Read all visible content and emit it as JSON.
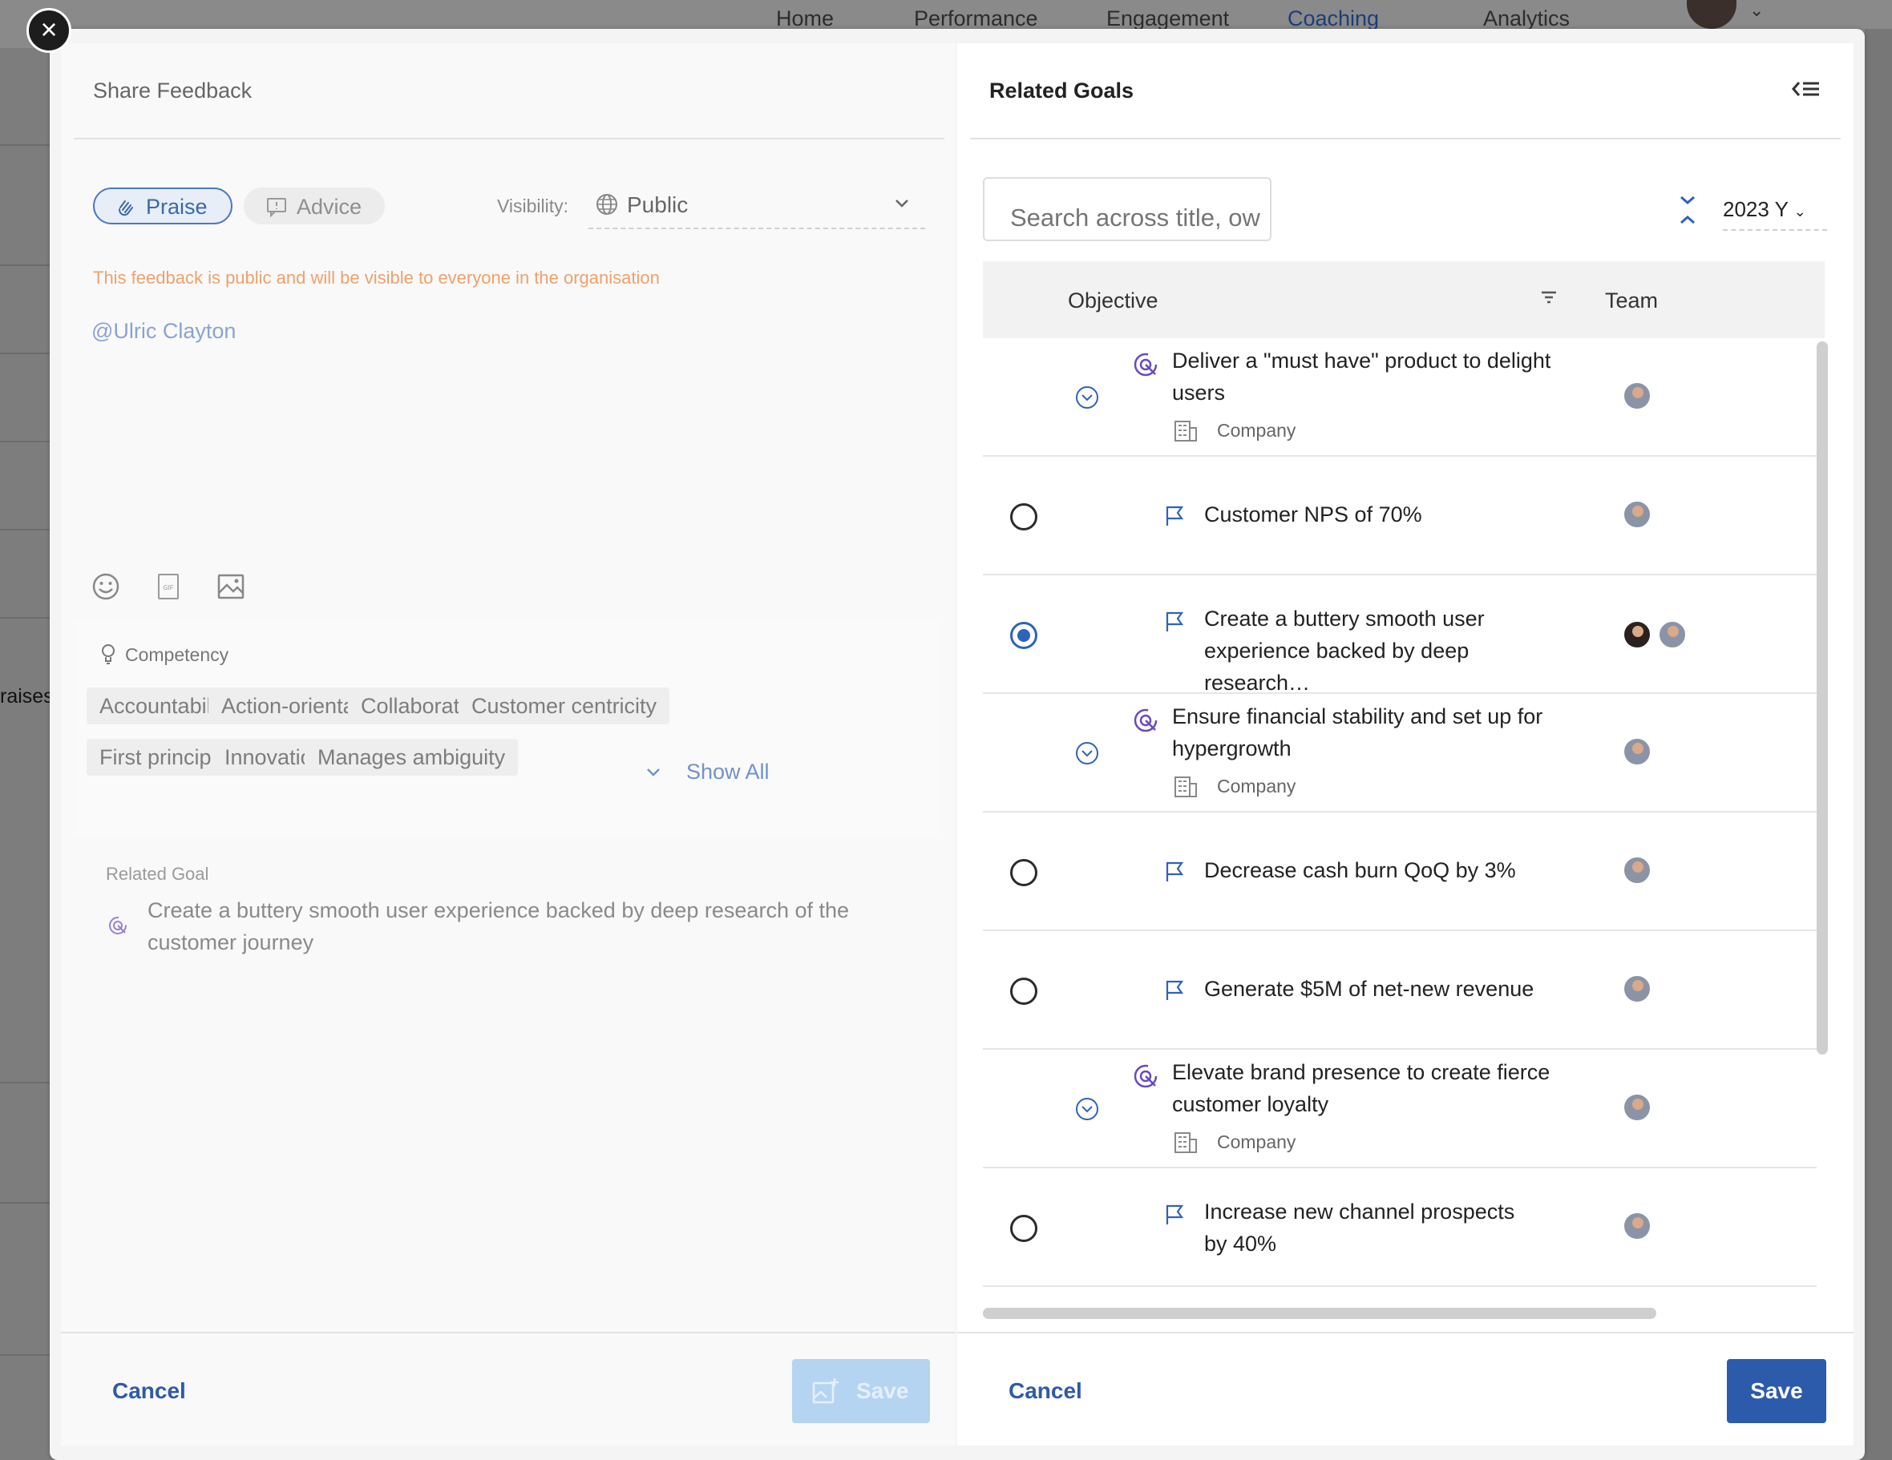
{
  "background": {
    "nav": [
      "Home",
      "Performance",
      "Engagement",
      "Coaching",
      "Analytics"
    ],
    "side_text": "raises"
  },
  "left_panel": {
    "title": "Share Feedback",
    "feedback_types": [
      {
        "label": "Praise",
        "selected": true
      },
      {
        "label": "Advice",
        "selected": false
      }
    ],
    "visibility_label": "Visibility:",
    "visibility_value": "Public",
    "visibility_warning": "This feedback is public and will be visible to everyone in the organisation",
    "mention": "@Ulric Clayton",
    "toolbar_icons": [
      "emoji-icon",
      "gif-icon",
      "image-icon"
    ],
    "competency_label": "Competency",
    "competencies": [
      "Accountability",
      "Action-orientation",
      "Collaboration",
      "Customer centricity",
      "First principles",
      "Innovation",
      "Manages ambiguity"
    ],
    "show_all": "Show All",
    "related_goal_label": "Related Goal",
    "related_goal_text": "Create a buttery smooth user experience backed by deep research of the customer journey",
    "cancel": "Cancel",
    "save": "Save"
  },
  "right_panel": {
    "title": "Related Goals",
    "search_placeholder": "Search across title, ow",
    "year": "2023 Y",
    "columns": {
      "objective": "Objective",
      "team": "Team"
    },
    "rows": [
      {
        "kind": "objective",
        "title": "Deliver a \"must have\" product to delight users",
        "type": "Company"
      },
      {
        "kind": "key-result",
        "title": "Customer NPS of 70%",
        "selected": false
      },
      {
        "kind": "key-result",
        "title": "Create a buttery smooth user experience backed by deep research…",
        "selected": true
      },
      {
        "kind": "objective",
        "title": "Ensure financial stability and set up for hypergrowth",
        "type": "Company"
      },
      {
        "kind": "key-result",
        "title": "Decrease cash burn QoQ by 3%",
        "selected": false
      },
      {
        "kind": "key-result",
        "title": "Generate $5M of net-new revenue",
        "selected": false
      },
      {
        "kind": "objective",
        "title": "Elevate brand presence to create fierce customer loyalty",
        "type": "Company"
      },
      {
        "kind": "key-result",
        "title": "Increase new channel prospects by 40%",
        "selected": false
      }
    ],
    "cancel": "Cancel",
    "save": "Save"
  },
  "colors": {
    "primary": "#2d5bab",
    "accent_purple": "#6a4bbd",
    "warning": "#f0a06b"
  }
}
